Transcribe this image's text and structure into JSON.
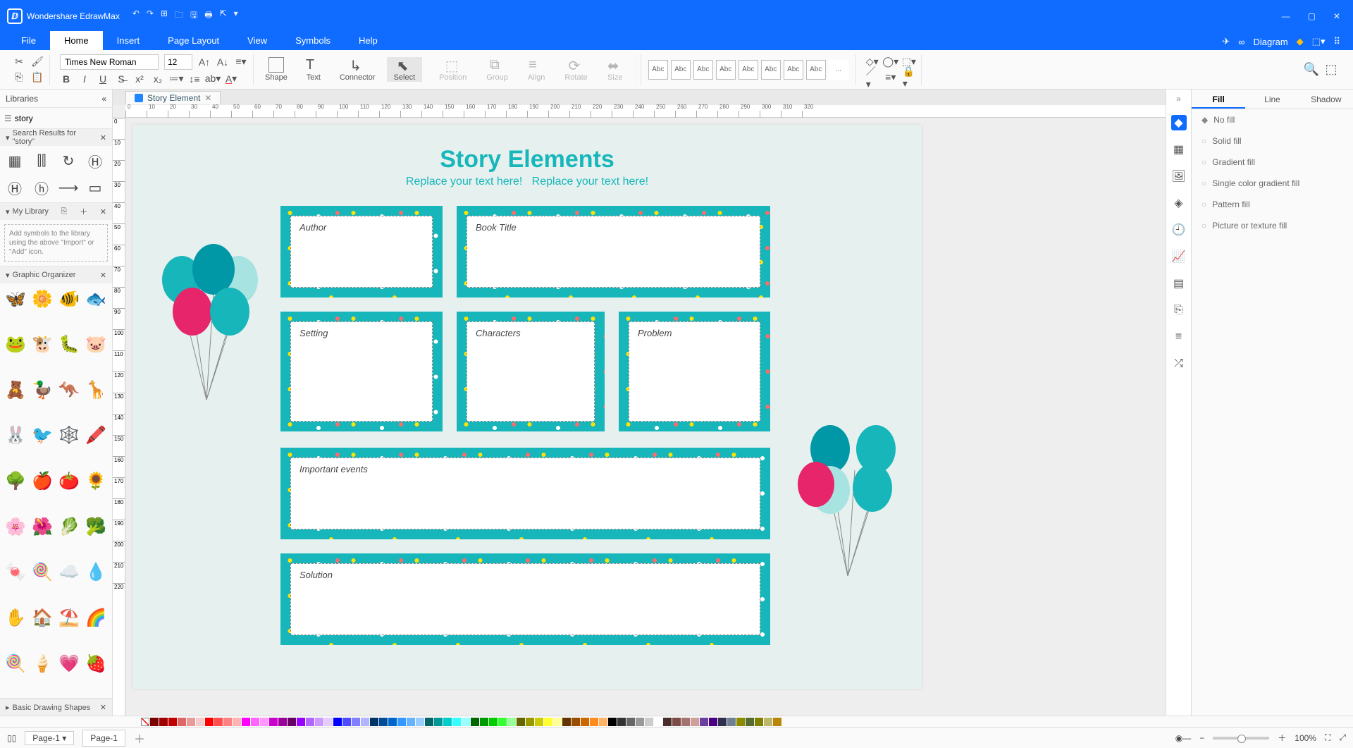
{
  "app": {
    "name": "Wondershare EdrawMax"
  },
  "menus": {
    "file": "File",
    "home": "Home",
    "insert": "Insert",
    "pagelayout": "Page Layout",
    "view": "View",
    "symbols": "Symbols",
    "help": "Help",
    "diagram": "Diagram"
  },
  "ribbon": {
    "font": "Times New Roman",
    "size": "12",
    "shape": "Shape",
    "text": "Text",
    "connector": "Connector",
    "select": "Select",
    "position": "Position",
    "group": "Group",
    "align": "Align",
    "rotate": "Rotate",
    "size_lbl": "Size",
    "abc": "Abc",
    "tdot": "..."
  },
  "left": {
    "title": "Libraries",
    "search": "story",
    "results_hdr": "Search Results for  \"story\"",
    "mylib": "My Library",
    "hint": "Add symbols to the library using the above \"Import\" or \"Add\" icon.",
    "graphic": "Graphic Organizer",
    "basic": "Basic Drawing Shapes",
    "emojis": [
      "🦋",
      "🌼",
      "🐠",
      "🐟",
      "🐸",
      "🐮",
      "🐛",
      "🐷",
      "🧸",
      "🦆",
      "🦘",
      "🦒",
      "🐰",
      "🐦",
      "🕸️",
      "🖍️",
      "🌳",
      "🍎",
      "🍅",
      "🌻",
      "🌸",
      "🌺",
      "🥬",
      "🥦",
      "🍬",
      "🍭",
      "☁️",
      "💧",
      "✋",
      "🏠",
      "⛱️",
      "🌈",
      "🍭",
      "🍦",
      "💗",
      "🍓"
    ]
  },
  "doc": {
    "tab": "Story Element",
    "title": "Story Elements",
    "sub1": "Replace your text here!",
    "sub2": "Replace your text here!",
    "author": "Author",
    "booktitle": "Book Title",
    "setting": "Setting",
    "characters": "Characters",
    "problem": "Problem",
    "events": "Important events",
    "solution": "Solution"
  },
  "right": {
    "fill": "Fill",
    "line": "Line",
    "shadow": "Shadow",
    "nofill": "No fill",
    "solid": "Solid fill",
    "gradient": "Gradient fill",
    "single": "Single color gradient fill",
    "pattern": "Pattern fill",
    "picture": "Picture or texture fill"
  },
  "status": {
    "page_sel": "Page-1",
    "page_tab": "Page-1",
    "zoom": "100%"
  },
  "colors": [
    "#7a0000",
    "#a00000",
    "#c00000",
    "#e06666",
    "#ea9999",
    "#f4cccc",
    "#ff0000",
    "#ff4d4d",
    "#ff8080",
    "#ffb3b3",
    "#ff00ff",
    "#ff66ff",
    "#ff99ff",
    "#cc00cc",
    "#990099",
    "#660066",
    "#9900ff",
    "#b266ff",
    "#cc99ff",
    "#e5ccff",
    "#0000ff",
    "#4d4dff",
    "#8080ff",
    "#b3b3ff",
    "#003366",
    "#004c99",
    "#0066cc",
    "#3399ff",
    "#66b3ff",
    "#99ccff",
    "#006666",
    "#009999",
    "#00cccc",
    "#33ffff",
    "#99ffff",
    "#006600",
    "#009900",
    "#00cc00",
    "#33ff33",
    "#99ff99",
    "#666600",
    "#999900",
    "#cccc00",
    "#ffff33",
    "#ffff99",
    "#663300",
    "#994d00",
    "#cc6600",
    "#ff8c1a",
    "#ffb366",
    "#000000",
    "#333333",
    "#666666",
    "#999999",
    "#cccccc",
    "#ffffff",
    "#4a2c2a",
    "#7b4b47",
    "#a5736f",
    "#cfa09b",
    "#6b3fa0",
    "#4b0082",
    "#2f2f4f",
    "#708090",
    "#8b8b00",
    "#556b2f",
    "#808000",
    "#bdb76b",
    "#b8860b"
  ]
}
